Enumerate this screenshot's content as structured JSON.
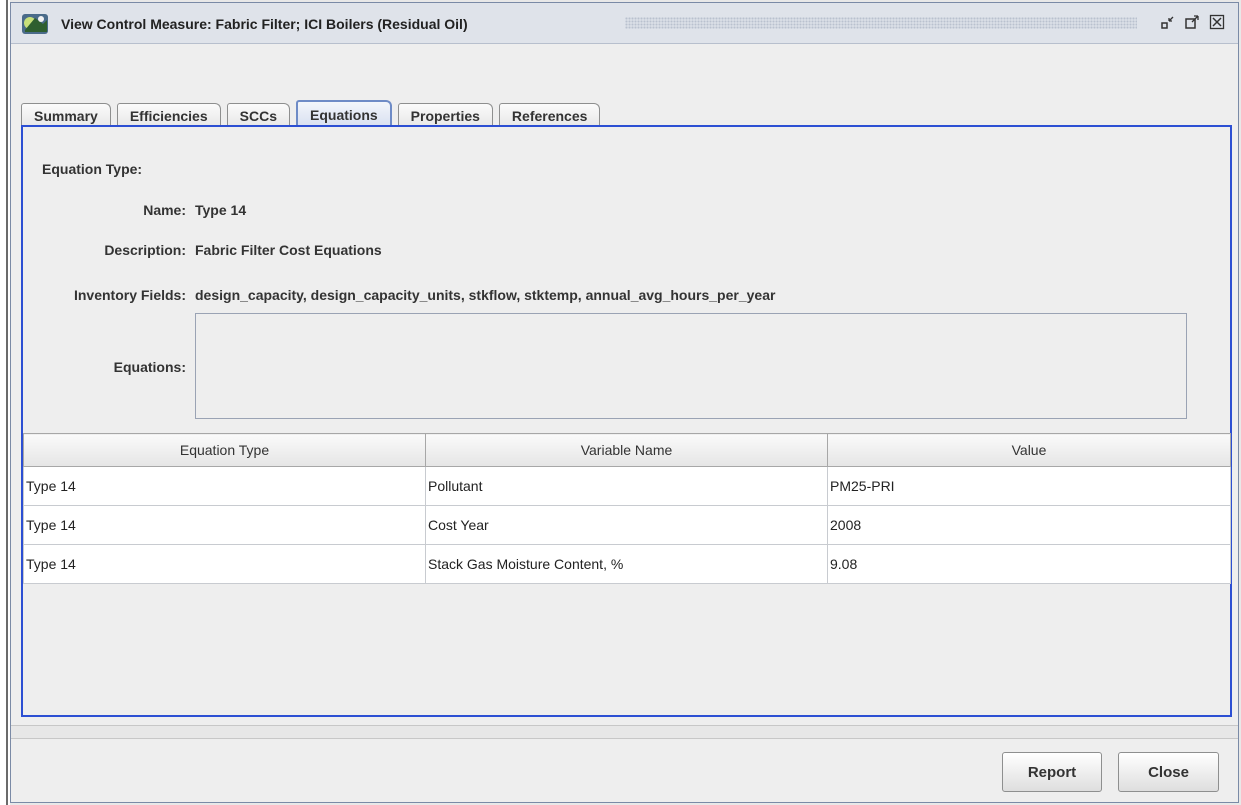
{
  "window": {
    "title": "View Control Measure: Fabric Filter; ICI Boilers (Residual Oil)",
    "app_icon": "emf-app-icon",
    "controls": [
      "minimize-icon",
      "maximize-icon",
      "close-icon"
    ]
  },
  "tabs": [
    {
      "label": "Summary",
      "active": false
    },
    {
      "label": "Efficiencies",
      "active": false
    },
    {
      "label": "SCCs",
      "active": false
    },
    {
      "label": "Equations",
      "active": true
    },
    {
      "label": "Properties",
      "active": false
    },
    {
      "label": "References",
      "active": false
    }
  ],
  "equation": {
    "type_label": "Equation Type:",
    "name_label": "Name:",
    "name_value": "Type 14",
    "description_label": "Description:",
    "description_value": "Fabric Filter Cost Equations",
    "inventory_label": "Inventory Fields:",
    "inventory_value": "design_capacity, design_capacity_units, stkflow, stktemp, annual_avg_hours_per_year",
    "equations_label": "Equations:",
    "equations_value": ""
  },
  "table": {
    "columns": [
      "Equation Type",
      "Variable Name",
      "Value"
    ],
    "rows": [
      [
        "Type 14",
        "Pollutant",
        "PM25-PRI"
      ],
      [
        "Type 14",
        "Cost Year",
        "2008"
      ],
      [
        "Type 14",
        "Stack Gas Moisture Content, %",
        "9.08"
      ]
    ]
  },
  "buttons": {
    "report": "Report",
    "close": "Close"
  },
  "colors": {
    "active_panel_border": "#2c4fd3",
    "active_tab_border": "#6e8bc6"
  }
}
